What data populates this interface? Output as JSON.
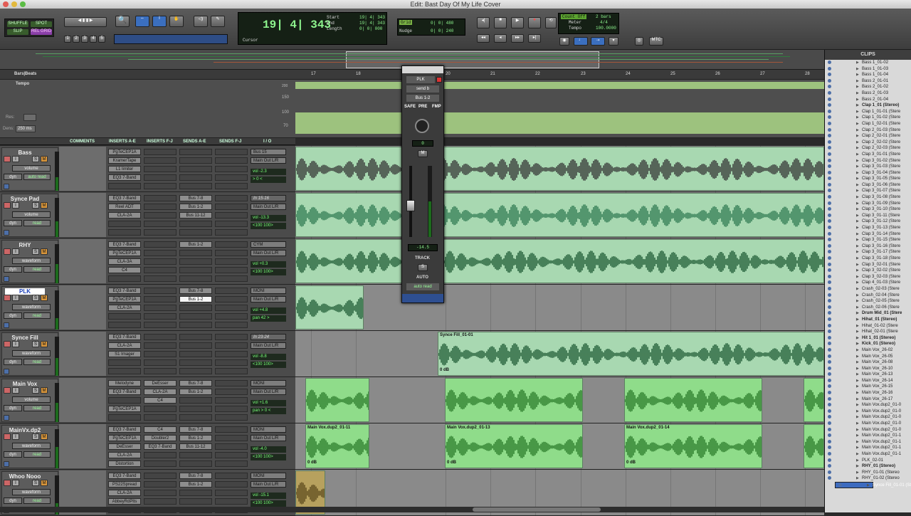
{
  "window": {
    "title": "Edit: Bast Day Of My Life Cover"
  },
  "toolbar": {
    "modes": [
      "SHUFFLE",
      "SPOT",
      "SLIP",
      "REL GRID"
    ],
    "zoom_presets": [
      "1",
      "2",
      "3",
      "4",
      "5"
    ],
    "counter_main": "19| 4| 343",
    "start_label": "Start",
    "start": "19| 4| 343",
    "end_label": "End",
    "end": "19| 4| 343",
    "length_label": "Length",
    "length": "0| 0| 000",
    "cursor_label": "Cursor",
    "grid_label": "Grid",
    "grid_value": "0| 0| 480",
    "nudge_label": "Nudge",
    "nudge_value": "0| 0| 240",
    "count_off": "Count Off",
    "count_bars": "2 bars",
    "meter_label": "Meter",
    "meter": "4/4",
    "tempo_label": "Tempo",
    "tempo": "100.0000",
    "midi": "MTC"
  },
  "rulers": {
    "bars_label": "Bars|Beats",
    "tempo_label": "Tempo",
    "bars": [
      "17",
      "18",
      "20",
      "21",
      "22",
      "23",
      "24",
      "25",
      "26",
      "27",
      "28"
    ],
    "tempo_ticks": [
      "150",
      "100",
      "70"
    ],
    "top_tick": "200"
  },
  "tempo_panel": {
    "res_label": "Res:",
    "dens_label": "Dens:",
    "dens_value": "250 ms"
  },
  "columns": {
    "comments": "COMMENTS",
    "inserts_ae": "INSERTS A-E",
    "inserts_fj": "INSERTS F-J",
    "sends_ae": "SENDS A-E",
    "sends_fj": "SENDS F-J",
    "io": "I / O"
  },
  "tracks": [
    {
      "name": "Bass",
      "view": "volume",
      "mode": "auto read",
      "ins": [
        "PgTeCEP1A",
        "KramerTape",
        "L1 limiter",
        "EQ3 7-Band"
      ],
      "insfj": [],
      "sends": [],
      "io_in": "Bus 15",
      "io_out": "Main Out L/R",
      "vol": "-2.3",
      "pan": "> 0 <",
      "vlabel": "vol",
      "plabel": "pan",
      "meter": 0.35
    },
    {
      "name": "Synce Pad",
      "view": "volume",
      "mode": "read",
      "ins": [
        "EQ3 7-Band",
        "Reel ADT",
        "CLA-2A"
      ],
      "insfj": [],
      "sends": [
        "Bus 7-8",
        "Bus 1-2",
        "Bus 11-12"
      ],
      "io_in": "In 15-16",
      "io_out": "Main Out L/R",
      "vol": "-13.3",
      "pan": "<100  100>",
      "vlabel": "vol",
      "plabel": "",
      "meter": 0.4
    },
    {
      "name": "RHY",
      "view": "waveform",
      "mode": "read",
      "ins": [
        "EQ3 7-Band",
        "PgTeCEP1A",
        "CLA-3A",
        "C4"
      ],
      "insfj": [],
      "sends": [
        "Bus 1-2"
      ],
      "io_in": "CYM",
      "io_out": "Main Out L/R",
      "vol": "+0.3",
      "pan": "<100  100>",
      "vlabel": "vol",
      "plabel": "",
      "meter": 0.5
    },
    {
      "name": "PLK",
      "view": "waveform",
      "mode": "read",
      "ins": [
        "EQ3 7-Band",
        "PgTeCEP1A",
        "CLA-2A"
      ],
      "insfj": [],
      "sends": [
        "Bus 7-8",
        "Bus 1-2"
      ],
      "io_in": "MONI",
      "io_out": "Main Out L/R",
      "vol": "+4.8",
      "pan": "pan   42 >",
      "vlabel": "vol",
      "plabel": "",
      "meter": 0.3
    },
    {
      "name": "Synce Fill",
      "view": "waveform",
      "mode": "read",
      "ins": [
        "EQ3 7-Band",
        "CLA-2A",
        "S1 Imager"
      ],
      "insfj": [],
      "sends": [],
      "io_in": "In 23-24",
      "io_out": "Main Out L/R",
      "vol": "-8.8",
      "pan": "<100  100>",
      "vlabel": "vol",
      "plabel": "",
      "meter": 0.45
    },
    {
      "name": "Main Vox",
      "view": "volume",
      "mode": "read",
      "ins": [
        "Melodyne",
        "EQ3 7-Band",
        "",
        "PgTeCEP1A"
      ],
      "insfj": [
        "DeEsser",
        "CLA-2A",
        "C4"
      ],
      "sends": [
        "Bus 7-8",
        "Bus 1-2"
      ],
      "io_in": "MONI",
      "io_out": "Main Out L/R",
      "vol": "+1.6",
      "pan": "pan   > 0 <",
      "vlabel": "vol",
      "plabel": "",
      "meter": 0.5
    },
    {
      "name": "MainVx.dp2",
      "view": "waveform",
      "mode": "read",
      "ins": [
        "EQ3 7-Band",
        "PgTeCEP1A",
        "DeEsser",
        "CLA-2A",
        "Distortion"
      ],
      "insfj": [
        "C4",
        "Doubler2",
        "EQ3 7-Band"
      ],
      "sends": [
        "Bus 7-8",
        "Bus 1-2",
        "Bus 11-12"
      ],
      "io_in": "MONI",
      "io_out": "Main Out L/R",
      "vol": "-4.0",
      "pan": "<100  100>",
      "vlabel": "vol",
      "plabel": "",
      "meter": 0.55
    },
    {
      "name": "Whoo Nooo",
      "view": "waveform",
      "mode": "read",
      "ins": [
        "EQ3 7-Band",
        "PS22Spread",
        "CLA-2A",
        "AbbeyRdPlts"
      ],
      "insfj": [],
      "sends": [
        "Bus 7-8",
        "Bus 1-2"
      ],
      "io_in": "MONI",
      "io_out": "Main Out L/R",
      "vol": "-15.1",
      "pan": "<100  100>",
      "vlabel": "vol",
      "plabel": "",
      "meter": 0.3
    }
  ],
  "clips_lane": {
    "synce_fill": "Synce Fill_01-01",
    "vox_dp2_a": "Main Vox.dup2_01-11",
    "vox_dp2_b": "Main Vox.dup2_01-13",
    "vox_dp2_c": "Main Vox.dup2_01-14",
    "gain": "0 dB"
  },
  "mixer": {
    "name": "PLK",
    "send": "send b",
    "bus": "Bus 1-2",
    "safe": "SAFE",
    "pre": "PRE",
    "fmp": "FMP",
    "pan_val": "0",
    "mute": "M",
    "fader_val": "-14.5",
    "track": "TRACK",
    "solo": "S",
    "auto": "AUTO",
    "auto_mode": "auto read"
  },
  "clips_list": {
    "title": "CLIPS",
    "items": [
      {
        "n": "Bass 1_01-02"
      },
      {
        "n": "Bass 1_01-03"
      },
      {
        "n": "Bass 1_01-04"
      },
      {
        "n": "Bass 2_01-01"
      },
      {
        "n": "Bass 2_01-02"
      },
      {
        "n": "Bass 2_01-03"
      },
      {
        "n": "Bass 2_01-04"
      },
      {
        "n": "Clap 1_01 (Stereo)",
        "b": 1
      },
      {
        "n": "Clap 1_01-01 (Stere"
      },
      {
        "n": "Clap 1_01-02 (Stere"
      },
      {
        "n": "Clap 1_02-01 (Stere"
      },
      {
        "n": "Clap 2_01-03 (Stere"
      },
      {
        "n": "Clap 2_02-01 (Stere"
      },
      {
        "n": "Clap 2_02-02 (Stere"
      },
      {
        "n": "Clap 2_02-03 (Stere"
      },
      {
        "n": "Clap 3_01-01 (Stere"
      },
      {
        "n": "Clap 3_01-02 (Stere"
      },
      {
        "n": "Clap 3_01-03 (Stere"
      },
      {
        "n": "Clap 3_01-04 (Stere"
      },
      {
        "n": "Clap 3_01-05 (Stere"
      },
      {
        "n": "Clap 3_01-06 (Stere"
      },
      {
        "n": "Clap 3_01-07 (Stere"
      },
      {
        "n": "Clap 3_01-08 (Stere"
      },
      {
        "n": "Clap 3_01-09 (Stere"
      },
      {
        "n": "Clap 3_01-10 (Stere"
      },
      {
        "n": "Clap 3_01-11 (Stere"
      },
      {
        "n": "Clap 3_01-12 (Stere"
      },
      {
        "n": "Clap 3_01-13 (Stere"
      },
      {
        "n": "Clap 3_01-14 (Stere"
      },
      {
        "n": "Clap 3_01-15 (Stere"
      },
      {
        "n": "Clap 3_01-16 (Stere"
      },
      {
        "n": "Clap 3_01-17 (Stere"
      },
      {
        "n": "Clap 3_01-18 (Stere"
      },
      {
        "n": "Clap 3_02-01 (Stere"
      },
      {
        "n": "Clap 3_02-02 (Stere"
      },
      {
        "n": "Clap 3_02-03 (Stere"
      },
      {
        "n": "Clap 4_01-03 (Stere"
      },
      {
        "n": "Crash_02-03 (Stere"
      },
      {
        "n": "Crash_02-04 (Stere"
      },
      {
        "n": "Crash_02-05 (Stere"
      },
      {
        "n": "Crash_02-06 (Stere"
      },
      {
        "n": "Drum Mid_01 (Stere",
        "b": 1
      },
      {
        "n": "Hihat_01 (Stereo)",
        "b": 1
      },
      {
        "n": "Hihat_01-02 (Stere"
      },
      {
        "n": "Hihat_02-01 (Stere"
      },
      {
        "n": "Hit 1_01 (Stereo)",
        "b": 1
      },
      {
        "n": "Kick_01 (Stereo)",
        "b": 1
      },
      {
        "n": "Main Vox_26-02"
      },
      {
        "n": "Main Vox_26-05"
      },
      {
        "n": "Main Vox_26-08"
      },
      {
        "n": "Main Vox_26-10"
      },
      {
        "n": "Main Vox_26-13"
      },
      {
        "n": "Main Vox_26-14"
      },
      {
        "n": "Main Vox_26-15"
      },
      {
        "n": "Main Vox_26-16"
      },
      {
        "n": "Main Vox_26-17"
      },
      {
        "n": "Main Vox.dup2_01-0"
      },
      {
        "n": "Main Vox.dup2_01-0"
      },
      {
        "n": "Main Vox.dup2_01-0"
      },
      {
        "n": "Main Vox.dup2_01-0"
      },
      {
        "n": "Main Vox.dup2_01-0"
      },
      {
        "n": "Main Vox.dup2_01-1"
      },
      {
        "n": "Main Vox.dup2_01-1"
      },
      {
        "n": "Main Vox.dup2_01-1"
      },
      {
        "n": "Main Vox.dup2_01-1"
      },
      {
        "n": "PLK_02-01"
      },
      {
        "n": "RHY_01 (Stereo)",
        "b": 1
      },
      {
        "n": "RHY_01-01 (Stereo"
      },
      {
        "n": "RHY_01-02 (Stereo"
      },
      {
        "n": "Synce Fill_01-01 (St",
        "s": 1
      }
    ]
  },
  "colors": {
    "clip_light": "#a8d8b1",
    "clip_dark": "#4a9f62",
    "clip_bright": "#8fdc8a",
    "tempo_lane": "#9dc27e",
    "selection": "#3d6bbf"
  }
}
